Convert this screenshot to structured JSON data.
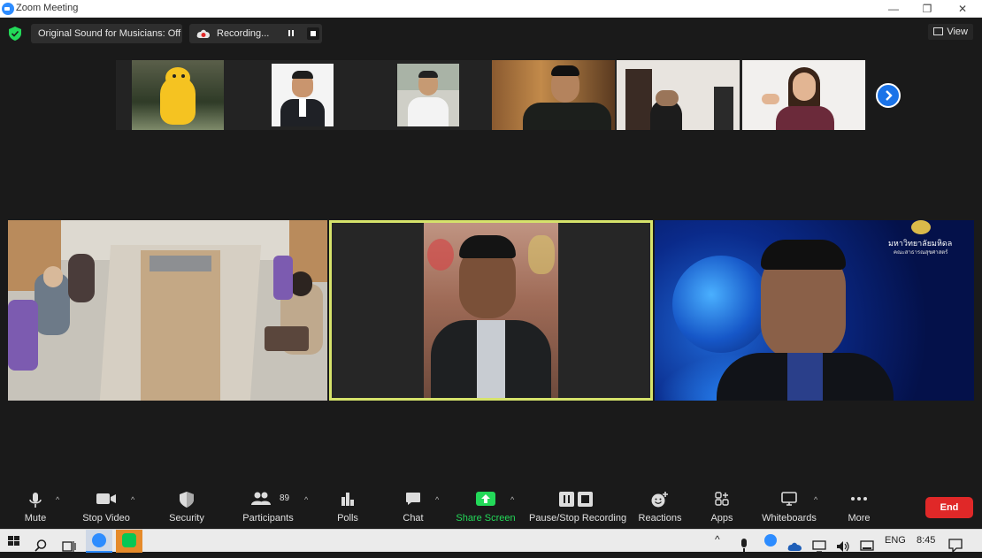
{
  "window": {
    "title": "Zoom Meeting",
    "minimize": "—",
    "restore": "❐",
    "close": "✕"
  },
  "topbar": {
    "original_sound": "Original Sound for Musicians: Off",
    "recording": "Recording...",
    "view": "View"
  },
  "thumbnails": [
    {
      "name": "mascot-thumbnail"
    },
    {
      "name": "participant-thumbnail-2"
    },
    {
      "name": "participant-thumbnail-3"
    },
    {
      "name": "participant-thumbnail-4"
    },
    {
      "name": "participant-thumbnail-5"
    },
    {
      "name": "participant-thumbnail-6"
    }
  ],
  "tiles": {
    "right_logo_text_1": "มหาวิทยาลัยมหิดล",
    "right_logo_text_2": "คณะสาธารณสุขศาสตร์"
  },
  "toolbar": {
    "mute": "Mute",
    "stop_video": "Stop Video",
    "security": "Security",
    "participants": "Participants",
    "participants_count": "89",
    "polls": "Polls",
    "chat": "Chat",
    "share_screen": "Share Screen",
    "pause_stop_recording": "Pause/Stop Recording",
    "reactions": "Reactions",
    "apps": "Apps",
    "whiteboards": "Whiteboards",
    "more": "More",
    "end": "End"
  },
  "taskbar": {
    "language": "ENG",
    "time": "8:45"
  },
  "colors": {
    "active_speaker_border": "#d6e36b",
    "share_green": "#23d959",
    "end_red": "#e02828",
    "zoom_blue": "#2d8cff"
  }
}
